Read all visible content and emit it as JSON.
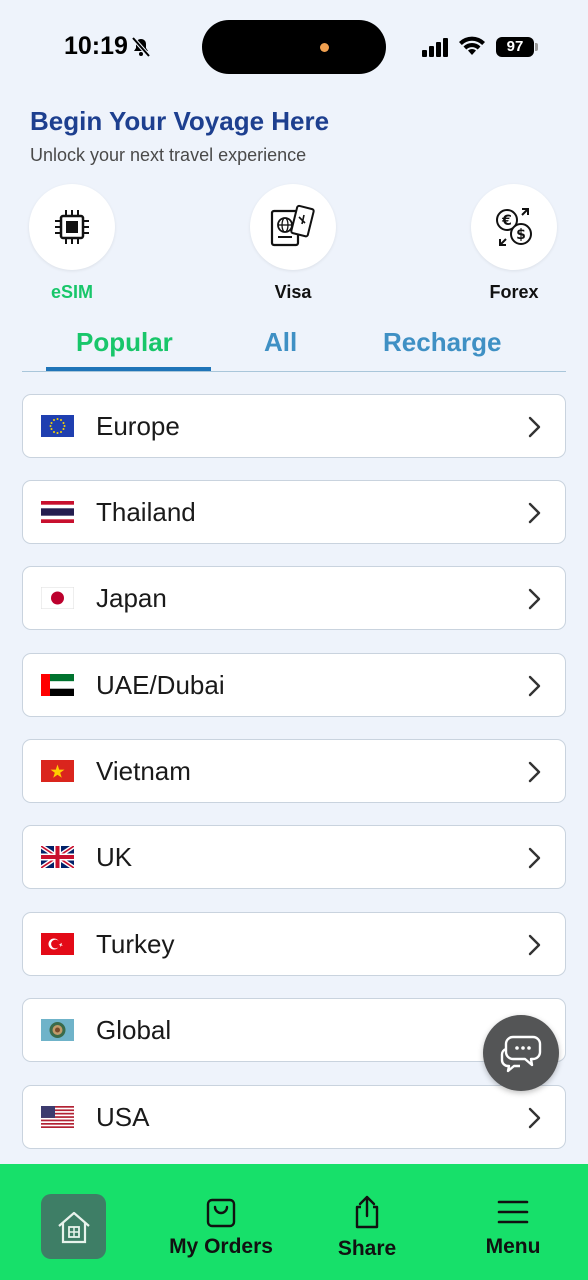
{
  "status_bar": {
    "time": "10:19",
    "battery": "97"
  },
  "header": {
    "title": "Begin Your Voyage Here",
    "subtitle": "Unlock your next travel experience"
  },
  "services": [
    {
      "label": "eSIM",
      "icon": "chip-icon",
      "active": true
    },
    {
      "label": "Visa",
      "icon": "passport-icon",
      "active": false
    },
    {
      "label": "Forex",
      "icon": "currency-exchange-icon",
      "active": false
    }
  ],
  "tabs": [
    {
      "label": "Popular",
      "active": true
    },
    {
      "label": "All",
      "active": false
    },
    {
      "label": "Recharge",
      "active": false
    }
  ],
  "countries": [
    {
      "name": "Europe",
      "flag": "eu"
    },
    {
      "name": "Thailand",
      "flag": "th"
    },
    {
      "name": "Japan",
      "flag": "jp"
    },
    {
      "name": "UAE/Dubai",
      "flag": "ae"
    },
    {
      "name": "Vietnam",
      "flag": "vn"
    },
    {
      "name": "UK",
      "flag": "gb"
    },
    {
      "name": "Turkey",
      "flag": "tr"
    },
    {
      "name": "Global",
      "flag": "globe"
    },
    {
      "name": "USA",
      "flag": "us"
    }
  ],
  "bottom_nav": {
    "home_icon": "home-icon",
    "my_orders": "My Orders",
    "share": "Share",
    "menu": "Menu"
  },
  "colors": {
    "accent_green": "#18c66a",
    "nav_green": "#17e06a",
    "title_blue": "#1d3f8f",
    "tab_blue": "#3f90c4"
  }
}
